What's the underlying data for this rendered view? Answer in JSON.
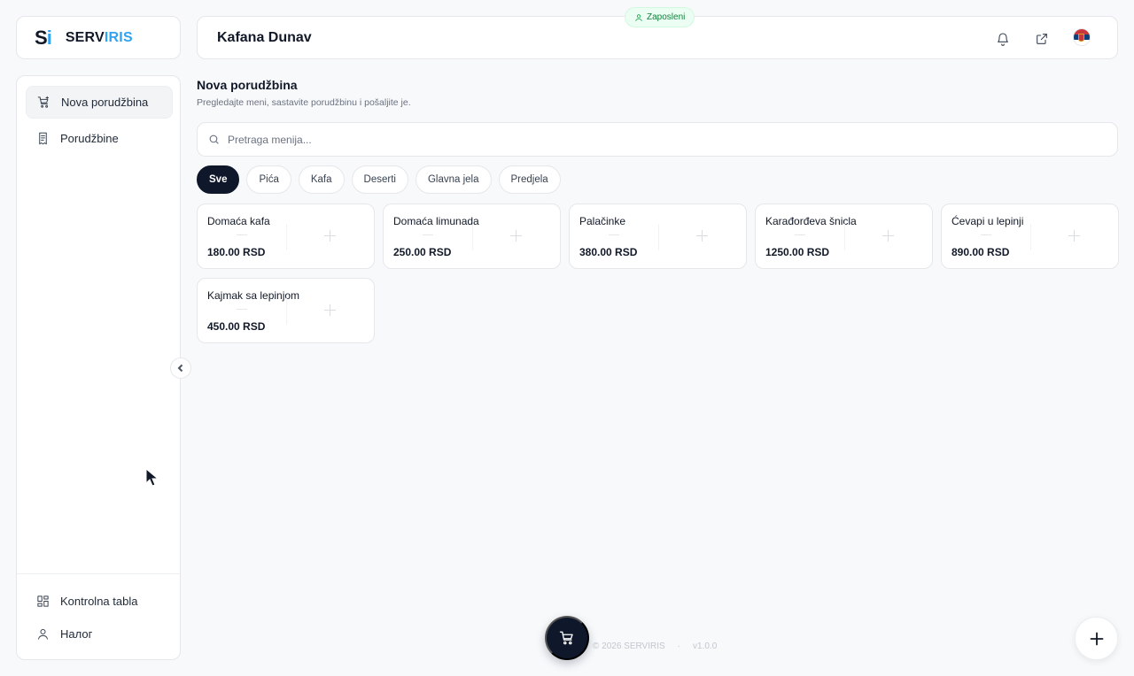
{
  "logo": {
    "mark_s": "S",
    "mark_i": "i",
    "text_a": "SERV",
    "text_b": "IRIS"
  },
  "sidebar": {
    "items": [
      {
        "label": "Nova porudžbina",
        "icon": "cart-plus-icon",
        "active": true
      },
      {
        "label": "Porudžbine",
        "icon": "receipt-icon",
        "active": false
      }
    ],
    "bottom_items": [
      {
        "label": "Kontrolna tabla",
        "icon": "dashboard-icon"
      },
      {
        "label": "Налог",
        "icon": "user-icon"
      }
    ]
  },
  "topbar": {
    "venue_name": "Kafana Dunav",
    "role_badge": "Zaposleni",
    "icons": [
      "bell-icon",
      "external-link-icon",
      "serbia-flag-icon"
    ]
  },
  "page": {
    "title": "Nova porudžbina",
    "subtitle": "Pregledajte meni, sastavite porudžbinu i pošaljite je."
  },
  "search": {
    "placeholder": "Pretraga menija...",
    "value": ""
  },
  "filters": [
    {
      "label": "Sve",
      "active": true
    },
    {
      "label": "Pića",
      "active": false
    },
    {
      "label": "Kafa",
      "active": false
    },
    {
      "label": "Deserti",
      "active": false
    },
    {
      "label": "Glavna jela",
      "active": false
    },
    {
      "label": "Predjela",
      "active": false
    }
  ],
  "menu_items": [
    {
      "name": "Domaća kafa",
      "price": "180.00 RSD"
    },
    {
      "name": "Domaća limunada",
      "price": "250.00 RSD"
    },
    {
      "name": "Palačinke",
      "price": "380.00 RSD"
    },
    {
      "name": "Karađorđeva šnicla",
      "price": "1250.00 RSD"
    },
    {
      "name": "Ćevapi u lepinji",
      "price": "890.00 RSD"
    },
    {
      "name": "Kajmak sa lepinjom",
      "price": "450.00 RSD"
    }
  ],
  "footer": {
    "copyright": "© 2026 SERVIRIS",
    "separator": "·",
    "version": "v1.0.0"
  },
  "colors": {
    "accent": "#2ea3f2",
    "dark": "#0f172a",
    "badge_green": "#15803d"
  }
}
